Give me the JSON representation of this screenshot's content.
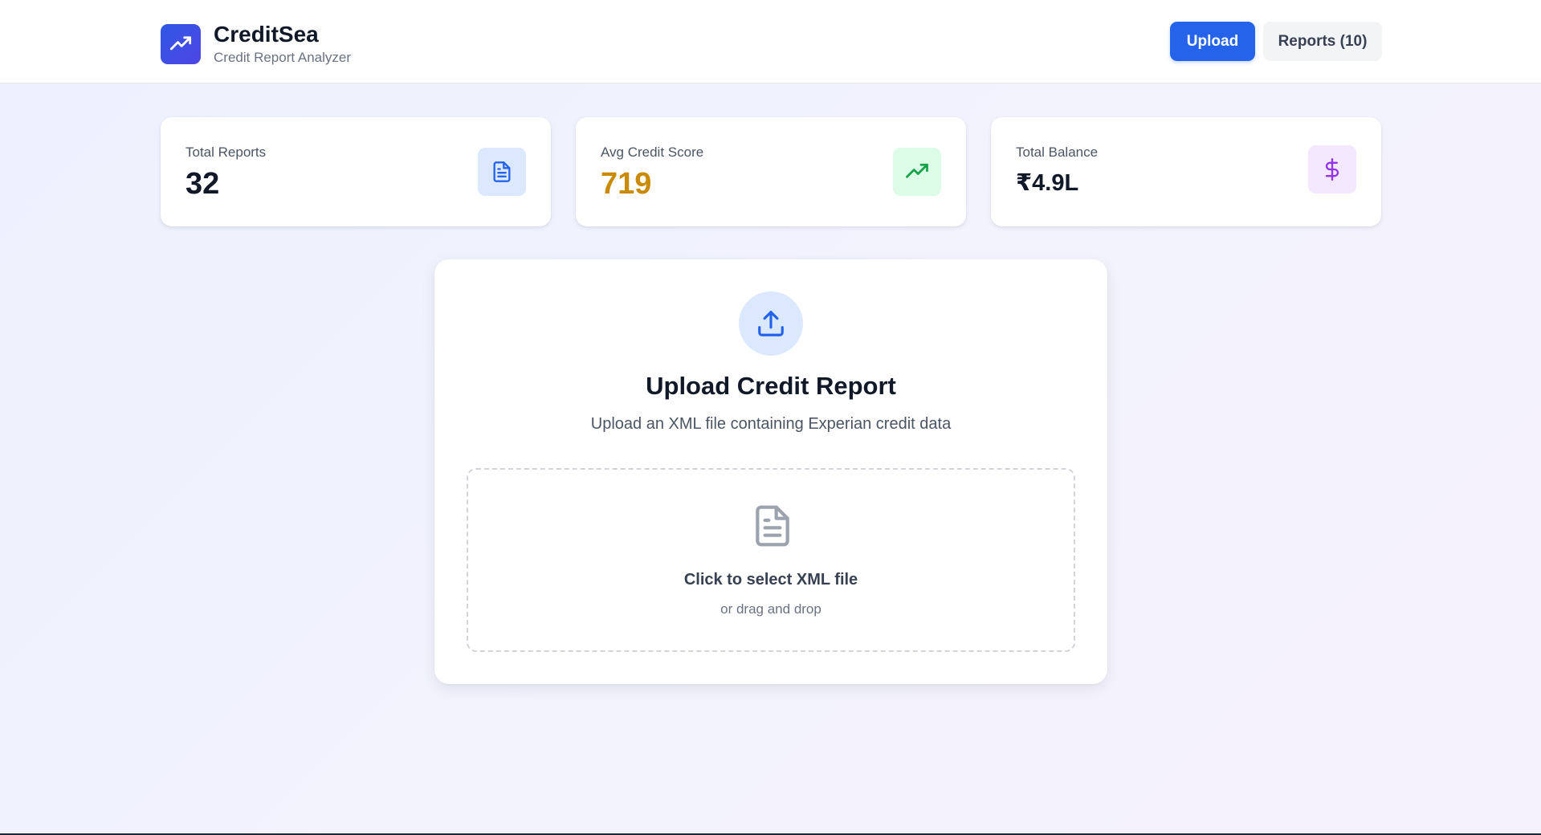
{
  "header": {
    "brand_title": "CreditSea",
    "brand_subtitle": "Credit Report Analyzer",
    "logo_icon": "trending-up-icon",
    "upload_label": "Upload",
    "reports_label": "Reports (10)"
  },
  "stats": [
    {
      "label": "Total Reports",
      "value": "32",
      "icon": "document-icon",
      "icon_color": "#2563eb",
      "icon_bg": "#dbe8fe"
    },
    {
      "label": "Avg Credit Score",
      "value": "719",
      "value_color": "#ca8a04",
      "icon": "trending-up-icon",
      "icon_color": "#16a34a",
      "icon_bg": "#dcfce7"
    },
    {
      "label": "Total Balance",
      "value": "₹4.9L",
      "icon": "dollar-icon",
      "icon_color": "#9333ea",
      "icon_bg": "#f3e8ff"
    }
  ],
  "upload": {
    "title": "Upload Credit Report",
    "description": "Upload an XML file containing Experian credit data",
    "icon": "upload-icon",
    "dropzone_title": "Click to select XML file",
    "dropzone_subtitle": "or drag and drop",
    "dropzone_icon": "file-icon"
  },
  "colors": {
    "primary": "#2563eb",
    "text_dark": "#111827",
    "text_muted": "#6b7280"
  }
}
